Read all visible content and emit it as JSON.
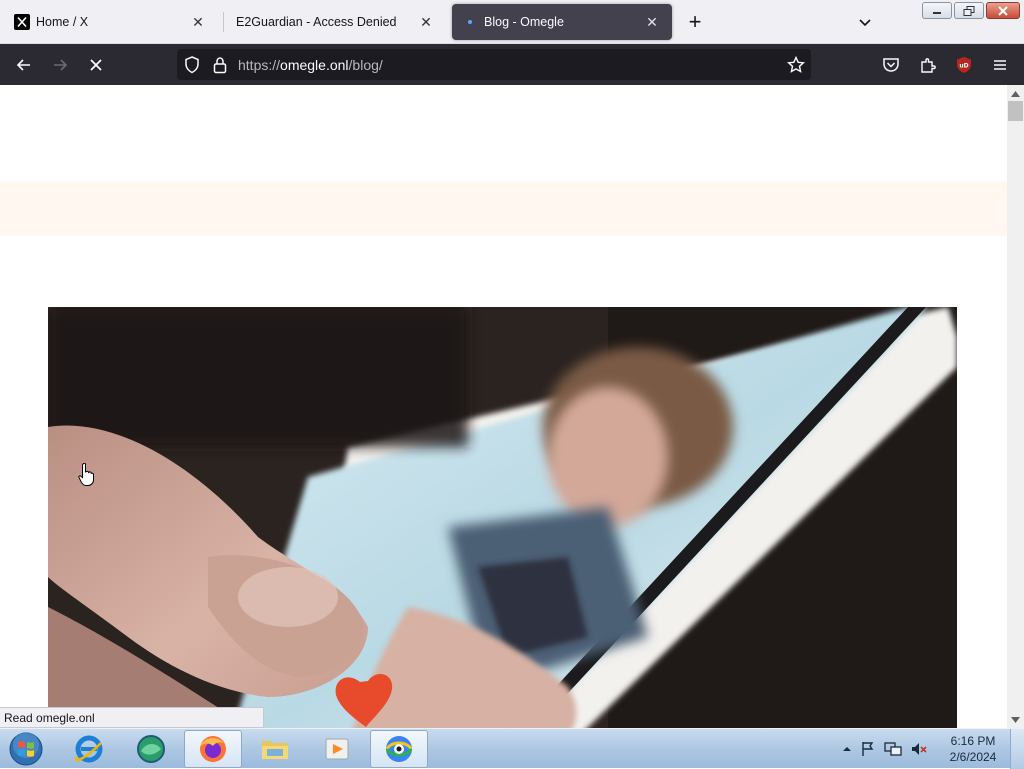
{
  "browser": {
    "tabs": [
      {
        "title": "Home / X",
        "favicon": "x-logo-icon",
        "active": false
      },
      {
        "title": "E2Guardian - Access Denied",
        "favicon": "none",
        "active": false
      },
      {
        "title": "Blog - Omegle",
        "favicon": "loading-dot-icon",
        "active": true
      }
    ],
    "address": {
      "scheme": "https://",
      "domain": "omegle.onl",
      "path": "/blog/"
    },
    "status_text": "Read omegle.onl"
  },
  "page": {
    "band_color": "#fff7f0",
    "hero_image": "blurred phone screen showing a person's profile photo, finger touching screen, heart icon"
  },
  "taskbar": {
    "apps": [
      "internet-explorer",
      "app-green-globe",
      "firefox",
      "file-explorer",
      "media-player",
      "browser-blue-eye"
    ],
    "active_app": "firefox",
    "clock_time": "6:16 PM",
    "clock_date": "2/6/2024"
  },
  "colors": {
    "tab_active_bg": "#42414d",
    "navbar_bg": "#2b2a33",
    "urlbar_bg": "#1c1b22",
    "ublock_red": "#b5271f"
  }
}
